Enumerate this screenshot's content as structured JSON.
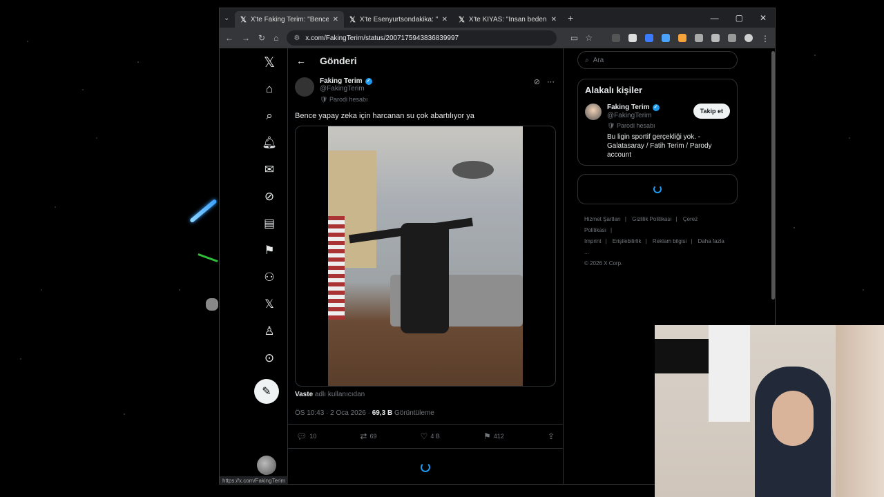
{
  "browser": {
    "tabs": [
      {
        "label": "X'te Faking Terim: \"Bence yapay",
        "active": true
      },
      {
        "label": "X'te Esenyurtsondakika: \"MilliP",
        "active": false
      },
      {
        "label": "X'te KIYAS: \"İnsan bedeni ne ka",
        "active": false
      }
    ],
    "url": "x.com/FakingTerim/status/2007175943836839997",
    "status_url": "https://x.com/FakingTerim"
  },
  "header": {
    "title": "Gönderi"
  },
  "post": {
    "author_name": "Faking Terim",
    "author_handle": "@FakingTerim",
    "parody_label": "Parodi hesabı",
    "text": "Bence yapay zeka için harcanan su çok abartılıyor ya",
    "credit_user": "Vaste",
    "credit_suffix": "adlı kullanıcıdan",
    "time": "ÖS 10:43 · 2 Oca 2026 ·",
    "views_count": "69,3 B",
    "views_label": "Görüntüleme",
    "replies": "10",
    "reposts": "69",
    "likes": "4 B",
    "bookmarks": "412"
  },
  "right": {
    "search_placeholder": "Ara",
    "related_title": "Alakalı kişiler",
    "related_name": "Faking Terim",
    "related_handle": "@FakingTerim",
    "related_parody": "Parodi hesabı",
    "related_bio": "Bu ligin sportif gerçekliği yok. - Galatasaray / Fatih Terim / Parody account",
    "follow_label": "Takip et",
    "footer": [
      "Hizmet Şartları",
      "|",
      "Gizlilik Politikası",
      "|",
      "Çerez Politikası",
      "|",
      "Imprint",
      "|",
      "Erişilebilirlik",
      "|",
      "Reklam bilgisi",
      "|",
      "Daha fazla ...",
      "© 2026 X Corp."
    ]
  },
  "colors": {
    "accent": "#1d9bf0",
    "bg": "#000000",
    "muted": "#71767b"
  }
}
